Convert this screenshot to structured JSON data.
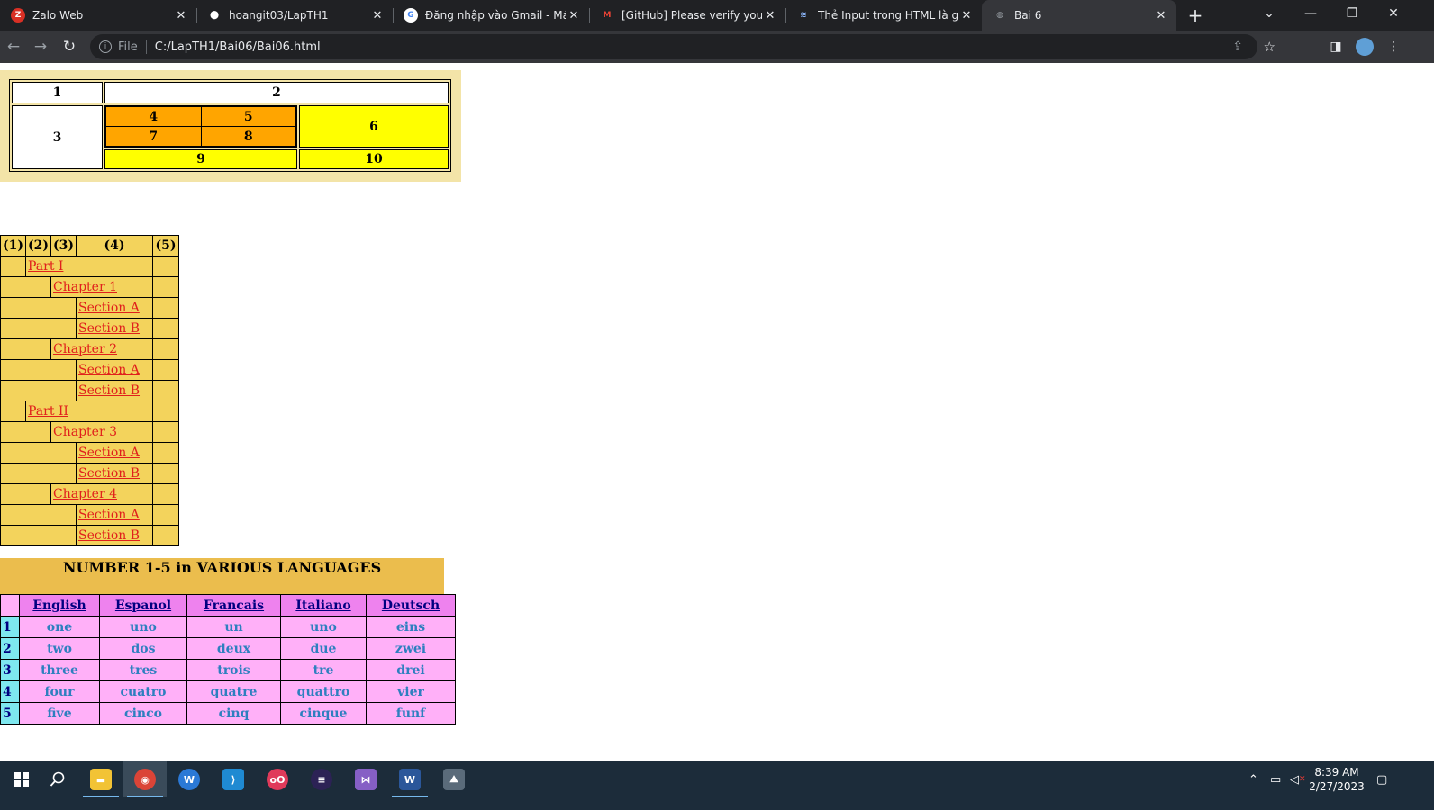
{
  "browser": {
    "tabs": [
      {
        "label": "Zalo Web",
        "icon": "zalo-icon",
        "color": "#d93025",
        "glyph": "Z"
      },
      {
        "label": "hoangit03/LapTH1",
        "icon": "github-icon",
        "color": "#ffffff",
        "glyph": "⬤"
      },
      {
        "label": "Đăng nhập vào Gmail - Máy t",
        "icon": "google-icon",
        "color": "#4285f4",
        "glyph": "G"
      },
      {
        "label": "[GitHub] Please verify your de",
        "icon": "gmail-icon",
        "color": "#ea4335",
        "glyph": "M"
      },
      {
        "label": "Thẻ Input trong HTML là gì? T",
        "icon": "layers-icon",
        "color": "#8ab4f8",
        "glyph": "≋"
      },
      {
        "label": "Bai 6",
        "icon": "globe-icon",
        "color": "#9aa0a6",
        "glyph": "◍"
      }
    ],
    "address": {
      "scheme": "File",
      "url": "C:/LapTH1/Bai06/Bai06.html"
    }
  },
  "table1": {
    "cells": [
      "1",
      "2",
      "3",
      "4",
      "5",
      "6",
      "7",
      "8",
      "9",
      "10"
    ]
  },
  "table2": {
    "headers": [
      "(1)",
      "(2)",
      "(3)",
      "(4)",
      "(5)"
    ],
    "rows": [
      {
        "level": 1,
        "label": "Part I"
      },
      {
        "level": 2,
        "label": "Chapter 1"
      },
      {
        "level": 3,
        "label": "Section A"
      },
      {
        "level": 3,
        "label": "Section B"
      },
      {
        "level": 2,
        "label": "Chapter 2"
      },
      {
        "level": 3,
        "label": "Section A"
      },
      {
        "level": 3,
        "label": "Section B"
      },
      {
        "level": 1,
        "label": "Part II"
      },
      {
        "level": 2,
        "label": "Chapter 3"
      },
      {
        "level": 3,
        "label": "Section A"
      },
      {
        "level": 3,
        "label": "Section B"
      },
      {
        "level": 2,
        "label": "Chapter 4"
      },
      {
        "level": 3,
        "label": "Section A"
      },
      {
        "level": 3,
        "label": "Section B"
      }
    ]
  },
  "table3": {
    "caption": "NUMBER 1-5 in VARIOUS LANGUAGES",
    "headers": [
      "English",
      "Espanol",
      "Francais",
      "Italiano",
      "Deutsch"
    ],
    "rows": [
      {
        "num": "1",
        "words": [
          "one",
          "uno",
          "un",
          "uno",
          "eins"
        ]
      },
      {
        "num": "2",
        "words": [
          "two",
          "dos",
          "deux",
          "due",
          "zwei"
        ]
      },
      {
        "num": "3",
        "words": [
          "three",
          "tres",
          "trois",
          "tre",
          "drei"
        ]
      },
      {
        "num": "4",
        "words": [
          "four",
          "cuatro",
          "quatre",
          "quattro",
          "vier"
        ]
      },
      {
        "num": "5",
        "words": [
          "five",
          "cinco",
          "cinq",
          "cinque",
          "funf"
        ]
      }
    ]
  },
  "taskbar": {
    "apps": [
      {
        "name": "file-explorer-icon",
        "color": "#f2c335",
        "glyph": "▬"
      },
      {
        "name": "chrome-icon",
        "color": "#db4437",
        "glyph": "◉"
      },
      {
        "name": "app-w-icon",
        "color": "#2b79d6",
        "glyph": "W"
      },
      {
        "name": "vscode-icon",
        "color": "#1f8ad2",
        "glyph": "⟩"
      },
      {
        "name": "app-oo-icon",
        "color": "#e03a5a",
        "glyph": "oO"
      },
      {
        "name": "eclipse-icon",
        "color": "#2c2255",
        "glyph": "≡"
      },
      {
        "name": "visual-studio-icon",
        "color": "#865fc5",
        "glyph": "⋈"
      },
      {
        "name": "word-icon",
        "color": "#2b579a",
        "glyph": "W"
      },
      {
        "name": "photos-icon",
        "color": "#5a6b7a",
        "glyph": "⛰"
      }
    ],
    "time": "8:39 AM",
    "date": "2/27/2023"
  }
}
